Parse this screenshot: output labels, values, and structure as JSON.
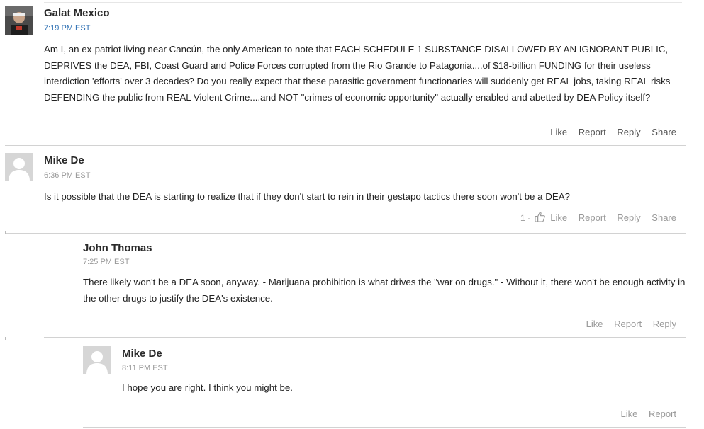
{
  "comments": [
    {
      "author": "Galat Mexico",
      "time": "7:19 PM EST",
      "text": "Am I, an ex-patriot living near Cancún, the only American to note that EACH SCHEDULE 1 SUBSTANCE DISALLOWED BY AN IGNORANT PUBLIC, DEPRIVES the DEA, FBI, Coast Guard and Police Forces corrupted from the Rio Grande to Patagonia....of $18-billion FUNDING for their useless interdiction 'efforts' over 3 decades? Do you really expect that these parasitic government functionaries will suddenly get REAL jobs, taking REAL risks DEFENDING the public from REAL Violent Crime....and NOT \"crimes of economic opportunity\" actually enabled and abetted by DEA Policy itself?",
      "actions": {
        "like": "Like",
        "report": "Report",
        "reply": "Reply",
        "share": "Share"
      }
    },
    {
      "author": "Mike De",
      "time": "6:36 PM EST",
      "text": "Is it possible that the DEA is starting to realize that if they don't start to rein in their gestapo tactics there soon won't be a DEA?",
      "like_count": "1 ·",
      "actions": {
        "like": "Like",
        "report": "Report",
        "reply": "Reply",
        "share": "Share"
      }
    },
    {
      "author": "John Thomas",
      "time": "7:25 PM EST",
      "text": "There likely won't be a DEA soon, anyway. - Marijuana prohibition is what drives the \"war on drugs.\" - Without it, there won't be enough activity in the other drugs to justify the DEA's existence.",
      "actions": {
        "like": "Like",
        "report": "Report",
        "reply": "Reply"
      }
    },
    {
      "author": "Mike De",
      "time": "8:11 PM EST",
      "text": "I hope you are right. I think you might be.",
      "actions": {
        "like": "Like",
        "report": "Report"
      }
    }
  ],
  "icons": {
    "thumbs_up": "thumbs-up-icon",
    "avatar_placeholder": "default-avatar-icon"
  },
  "colors": {
    "timestamp_blue": "#2c6fb3",
    "muted": "#999999",
    "separator": "#d2d2d2"
  }
}
